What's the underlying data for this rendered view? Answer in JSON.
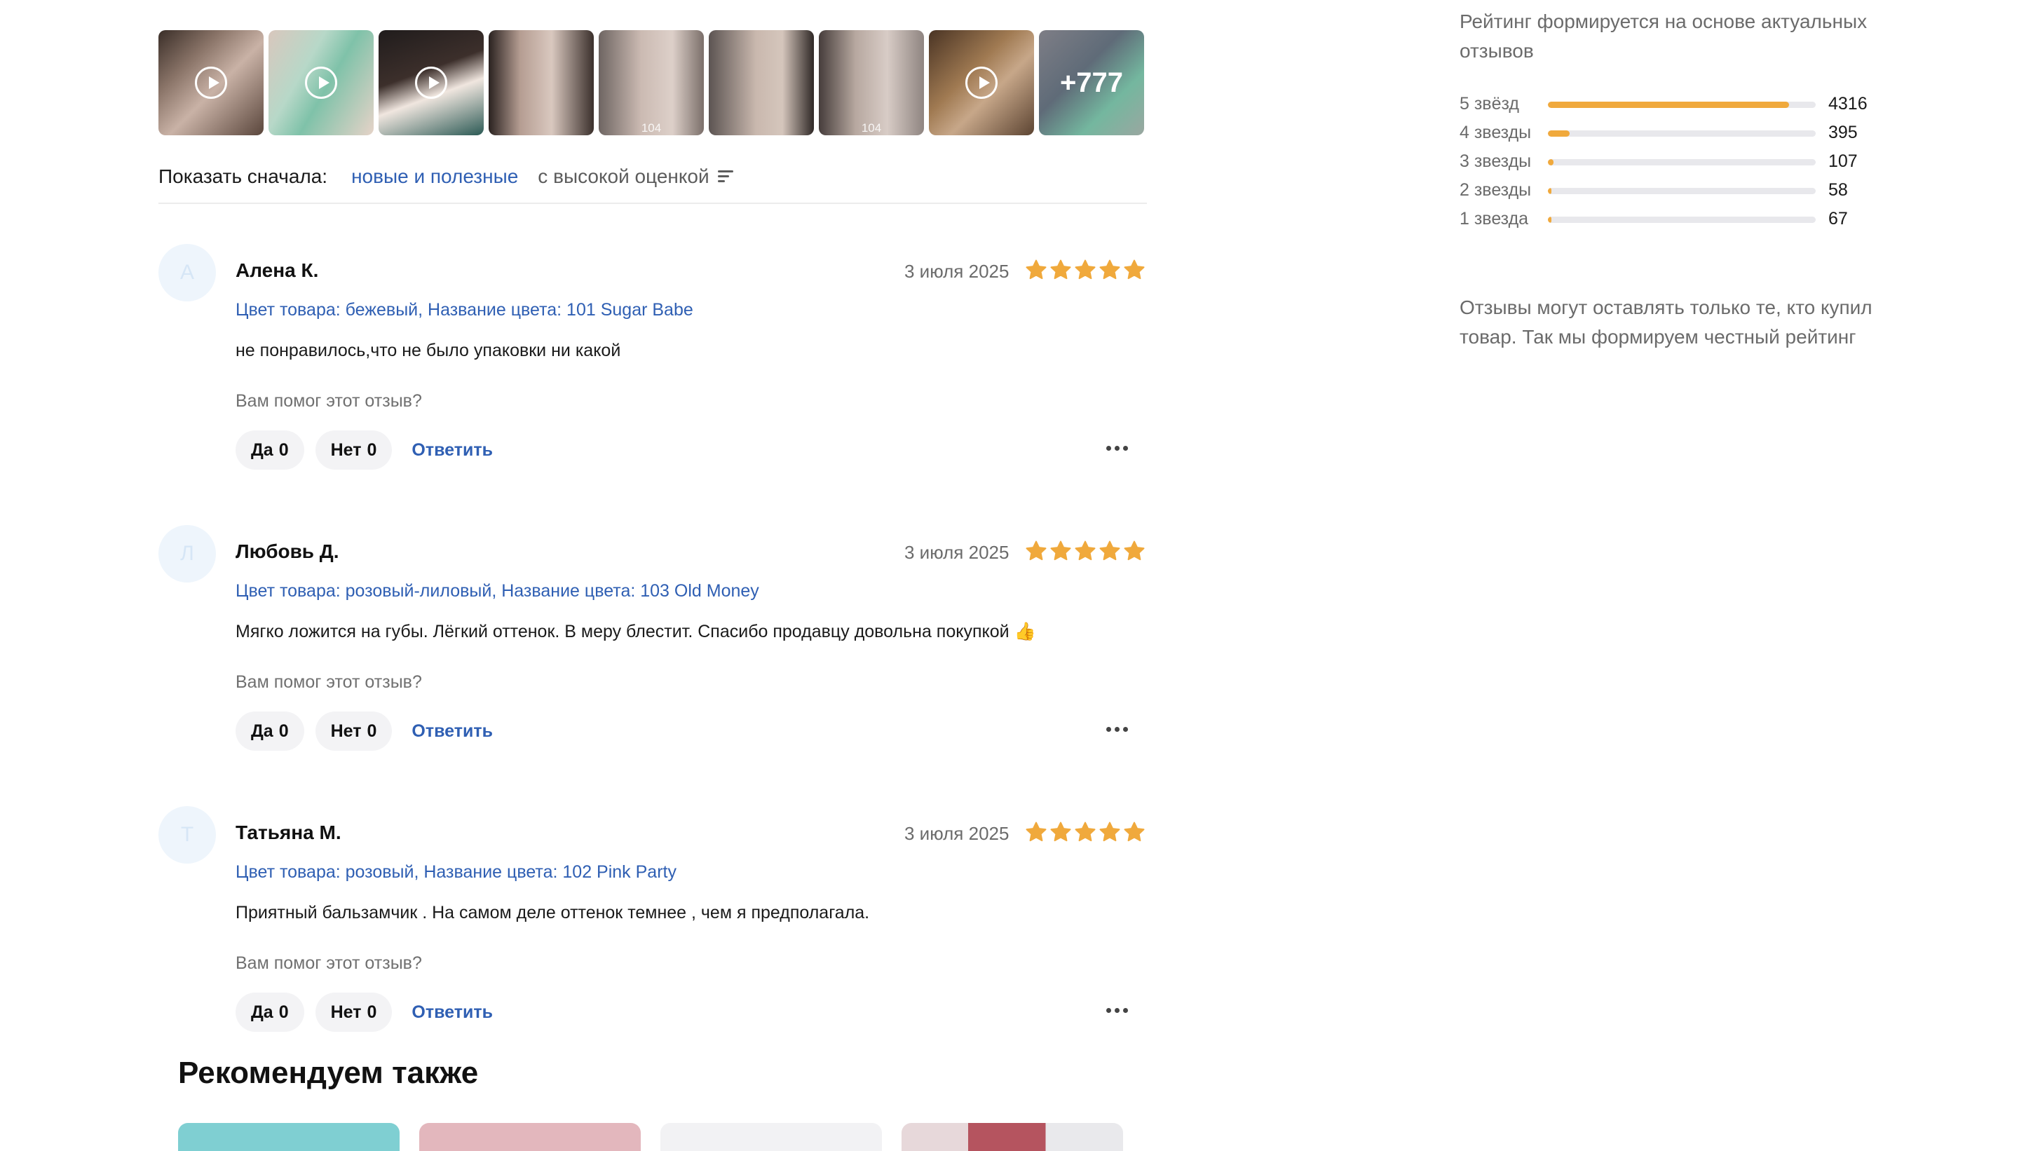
{
  "thumbnails": [
    {
      "type": "video",
      "caption": ""
    },
    {
      "type": "video",
      "caption": ""
    },
    {
      "type": "video",
      "caption": ""
    },
    {
      "type": "photo",
      "caption": ""
    },
    {
      "type": "photo",
      "caption": "104"
    },
    {
      "type": "photo",
      "caption": ""
    },
    {
      "type": "photo",
      "caption": "104"
    },
    {
      "type": "video",
      "caption": ""
    },
    {
      "type": "more",
      "caption": "+777"
    }
  ],
  "sort": {
    "label": "Показать сначала:",
    "option_active": "новые и полезные",
    "option_other": "с высокой оценкой"
  },
  "reviews": [
    {
      "initial": "А",
      "name": "Алена К.",
      "date": "3 июля 2025",
      "rating": 5,
      "variant": "Цвет товара: бежевый, Название цвета: 101 Sugar Babe",
      "text": "не понравилось,что не было упаковки ни какой",
      "help_question": "Вам помог этот отзыв?",
      "yes_label": "Да",
      "yes_count": "0",
      "no_label": "Нет",
      "no_count": "0",
      "reply_label": "Ответить"
    },
    {
      "initial": "Л",
      "name": "Любовь Д.",
      "date": "3 июля 2025",
      "rating": 5,
      "variant": "Цвет товара: розовый-лиловый, Название цвета: 103 Old Money",
      "text": "Мягко ложится на губы. Лёгкий оттенок. В меру блестит. Спасибо продавцу довольна покупкой 👍",
      "help_question": "Вам помог этот отзыв?",
      "yes_label": "Да",
      "yes_count": "0",
      "no_label": "Нет",
      "no_count": "0",
      "reply_label": "Ответить"
    },
    {
      "initial": "Т",
      "name": "Татьяна М.",
      "date": "3 июля 2025",
      "rating": 5,
      "variant": "Цвет товара: розовый, Название цвета: 102 Pink Party",
      "text": "Приятный бальзамчик . На самом деле оттенок темнее , чем я предполагала.",
      "help_question": "Вам помог этот отзыв?",
      "yes_label": "Да",
      "yes_count": "0",
      "no_label": "Нет",
      "no_count": "0",
      "reply_label": "Ответить"
    }
  ],
  "sidebar": {
    "note_top": "Рейтинг формируется на основе актуальных отзывов",
    "ratings": [
      {
        "label": "5 звёзд",
        "count": "4316",
        "fraction": 0.9
      },
      {
        "label": "4 звезды",
        "count": "395",
        "fraction": 0.08
      },
      {
        "label": "3 звезды",
        "count": "107",
        "fraction": 0.022
      },
      {
        "label": "2 звезды",
        "count": "58",
        "fraction": 0.012
      },
      {
        "label": "1 звезда",
        "count": "67",
        "fraction": 0.014
      }
    ],
    "note_bottom": "Отзывы могут оставлять только те, кто купил товар. Так мы формируем честный рейтинг"
  },
  "recommend": {
    "title": "Рекомендуем также"
  },
  "colors": {
    "accent_link": "#2f5fb3",
    "star": "#f0a93c",
    "rating_bar": "#f0a93c"
  }
}
